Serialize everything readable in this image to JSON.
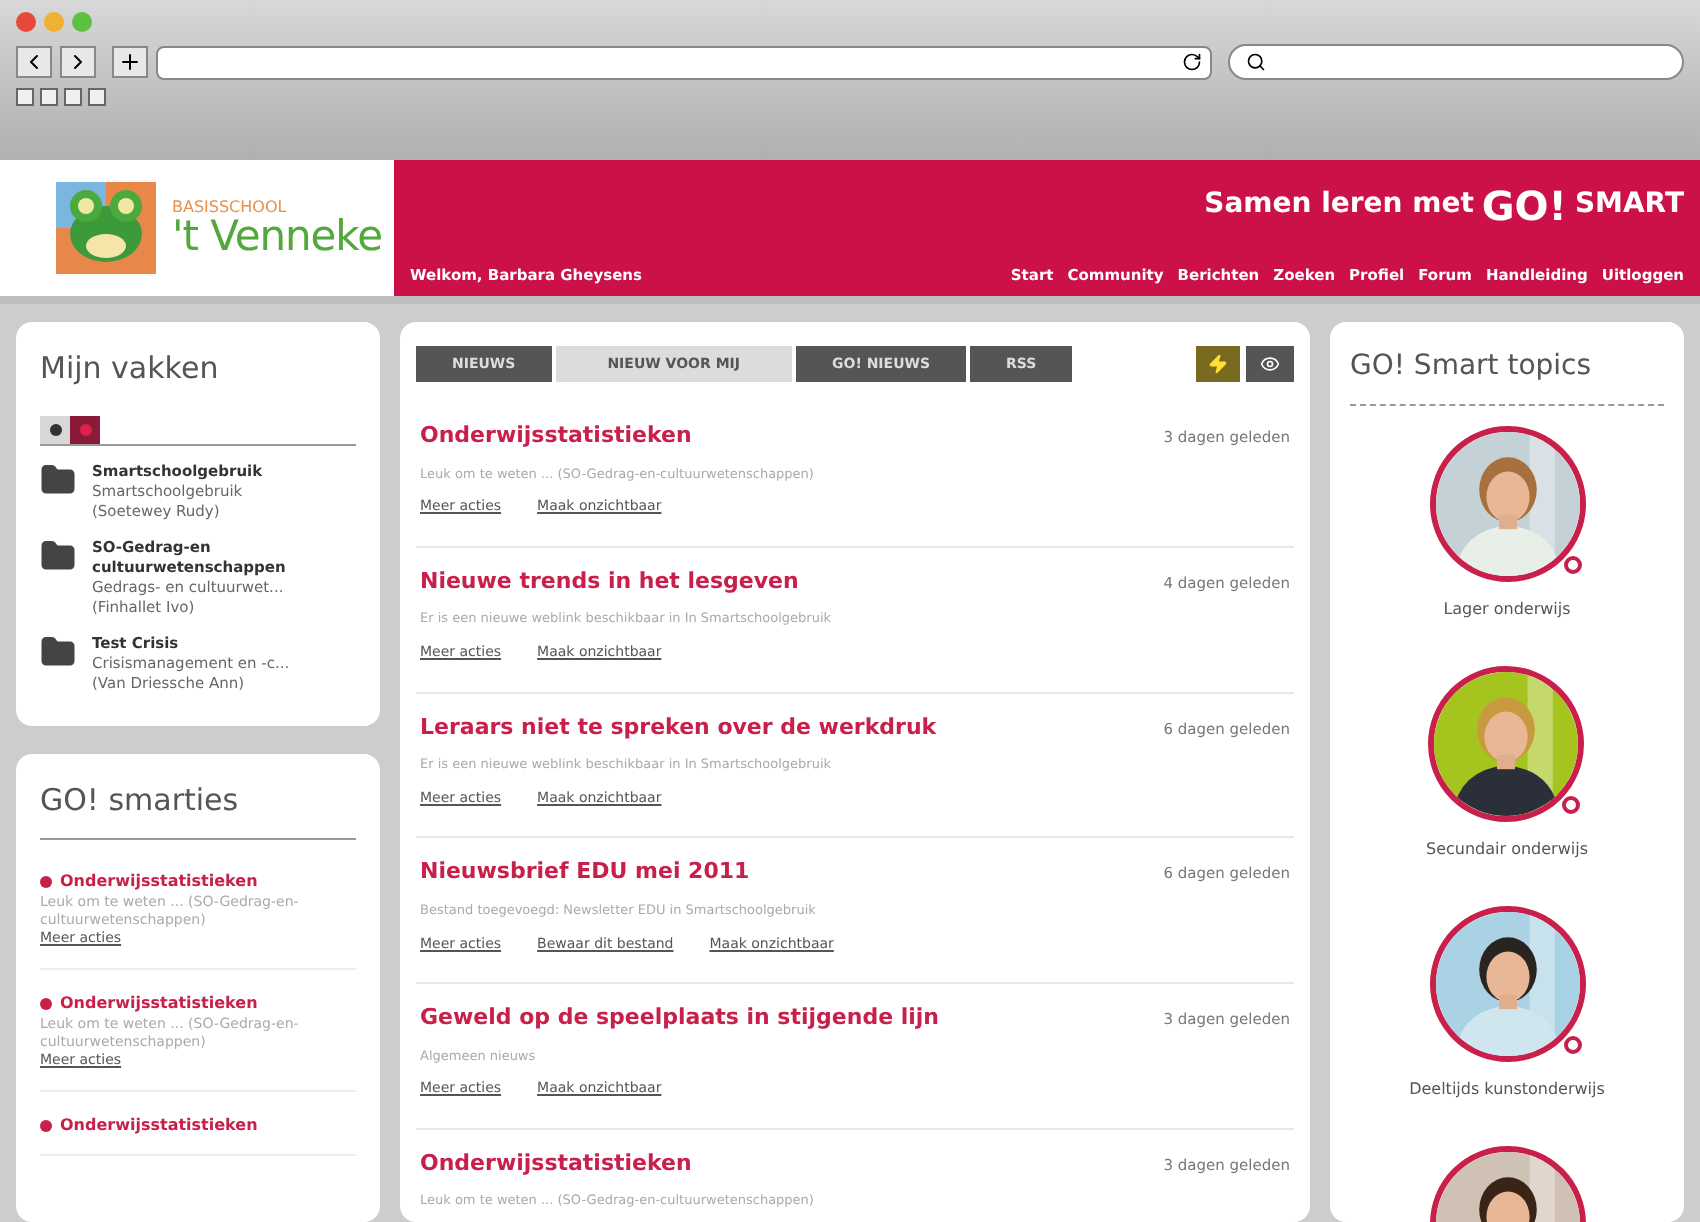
{
  "header": {
    "school_small": "BASISSCHOOL",
    "school_name": "'t Venneke",
    "slogan": "Samen leren met",
    "brand_go": "GO!",
    "brand_smart": "SMART",
    "welcome": "Welkom, Barbara Gheysens",
    "nav": [
      "Start",
      "Community",
      "Berichten",
      "Zoeken",
      "Profiel",
      "Forum",
      "Handleiding",
      "Uitloggen"
    ]
  },
  "courses": {
    "title": "Mijn vakken",
    "view_tabs": [
      {
        "selected": false
      },
      {
        "selected": true
      }
    ],
    "items": [
      {
        "name": "Smartschoolgebruik",
        "subtitle": "Smartschoolgebruik",
        "teacher": "(Soetewey Rudy)"
      },
      {
        "name": "SO-Gedrag-en cultuurwetenschappen",
        "subtitle": "Gedrags- en cultuurwet...",
        "teacher": "(Finhallet Ivo)"
      },
      {
        "name": "Test Crisis",
        "subtitle": "Crisismanagement en -c...",
        "teacher": "(Van Driessche Ann)"
      }
    ]
  },
  "smarties": {
    "title": "GO! smarties",
    "items": [
      {
        "title": "Onderwijsstatistieken",
        "text": "Leuk om te weten ... (SO-Gedrag-en-cultuurwetenschappen)",
        "link": "Meer acties"
      },
      {
        "title": "Onderwijsstatistieken",
        "text": "Leuk om te weten ... (SO-Gedrag-en-cultuurwetenschappen)",
        "link": "Meer acties"
      },
      {
        "title": "Onderwijsstatistieken"
      }
    ]
  },
  "news": {
    "tabs": [
      {
        "label": "NIEUWS",
        "selected": false
      },
      {
        "label": "NIEUW VOOR MIJ",
        "selected": true
      },
      {
        "label": "GO! NIEUWS",
        "selected": false
      },
      {
        "label": "RSS",
        "selected": false
      }
    ],
    "items": [
      {
        "title": "Onderwijsstatistieken",
        "date": "3 dagen geleden",
        "text": "Leuk om te weten ... (SO-Gedrag-en-cultuurwetenschappen)",
        "links": [
          "Meer acties",
          "Maak onzichtbaar"
        ]
      },
      {
        "title": "Nieuwe trends in het lesgeven",
        "date": "4 dagen geleden",
        "text": "Er is een nieuwe weblink beschikbaar in In Smartschoolgebruik",
        "links": [
          "Meer acties",
          "Maak onzichtbaar"
        ]
      },
      {
        "title": "Leraars niet te spreken over de werkdruk",
        "date": "6 dagen geleden",
        "text": "Er is een nieuwe weblink beschikbaar in In Smartschoolgebruik",
        "links": [
          "Meer acties",
          "Maak onzichtbaar"
        ]
      },
      {
        "title": "Nieuwsbrief EDU mei 2011",
        "date": "6 dagen geleden",
        "text": "Bestand toegevoegd: Newsletter EDU in Smartschoolgebruik",
        "links": [
          "Meer acties",
          "Bewaar dit bestand",
          "Maak onzichtbaar"
        ]
      },
      {
        "title": "Geweld op de speelplaats in stijgende lijn",
        "date": "3 dagen geleden",
        "text": "Algemeen nieuws",
        "links": [
          "Meer acties",
          "Maak onzichtbaar"
        ]
      },
      {
        "title": "Onderwijsstatistieken",
        "date": "3 dagen geleden",
        "text": "Leuk om te weten ... (SO-Gedrag-en-cultuurwetenschappen)"
      }
    ]
  },
  "topics": {
    "title": "GO! Smart topics",
    "items": [
      {
        "kind": "picture",
        "label": "Lager onderwijs"
      },
      {
        "kind": "picture",
        "label": "Secundair onderwijs"
      },
      {
        "kind": "picture",
        "label": "Deeltijds kunstonderwijs"
      },
      {
        "kind": "picture"
      }
    ]
  }
}
